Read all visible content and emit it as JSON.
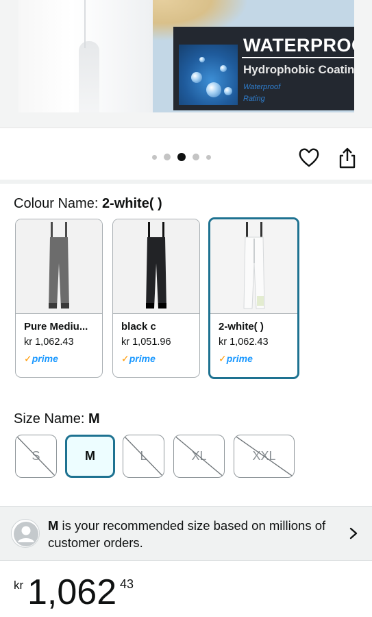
{
  "hero": {
    "badge_title": "WATERPROOF",
    "badge_subtitle": "Hydrophobic Coating",
    "badge_small1": "Waterproof",
    "badge_small2": "Rating"
  },
  "carousel": {
    "dot_count": 5,
    "active_index": 2
  },
  "colour": {
    "label": "Colour Name: ",
    "selected": "2-white( )",
    "options": [
      {
        "name": "Pure Mediu...",
        "price": "kr 1,062.43",
        "prime": "prime",
        "color": "#6c6c6c",
        "selected": false
      },
      {
        "name": "black c",
        "price": "kr 1,051.96",
        "prime": "prime",
        "color": "#222326",
        "selected": false
      },
      {
        "name": "2-white( )",
        "price": "kr 1,062.43",
        "prime": "prime",
        "color": "#f7f8f9",
        "selected": true
      }
    ]
  },
  "size": {
    "label": "Size Name: ",
    "selected": "M",
    "options": [
      {
        "label": "S",
        "available": false
      },
      {
        "label": "M",
        "available": true,
        "selected": true
      },
      {
        "label": "L",
        "available": false
      },
      {
        "label": "XL",
        "available": false
      },
      {
        "label": "XXL",
        "available": false
      }
    ]
  },
  "recommendation": {
    "bold": "M",
    "text": " is your recommended size based on millions of customer orders."
  },
  "price": {
    "currency": "kr",
    "whole": "1,062",
    "fraction": "43"
  },
  "colors": {
    "accent": "#1e7291",
    "prime_blue": "#1a98ff",
    "prime_check": "#ff9900"
  }
}
